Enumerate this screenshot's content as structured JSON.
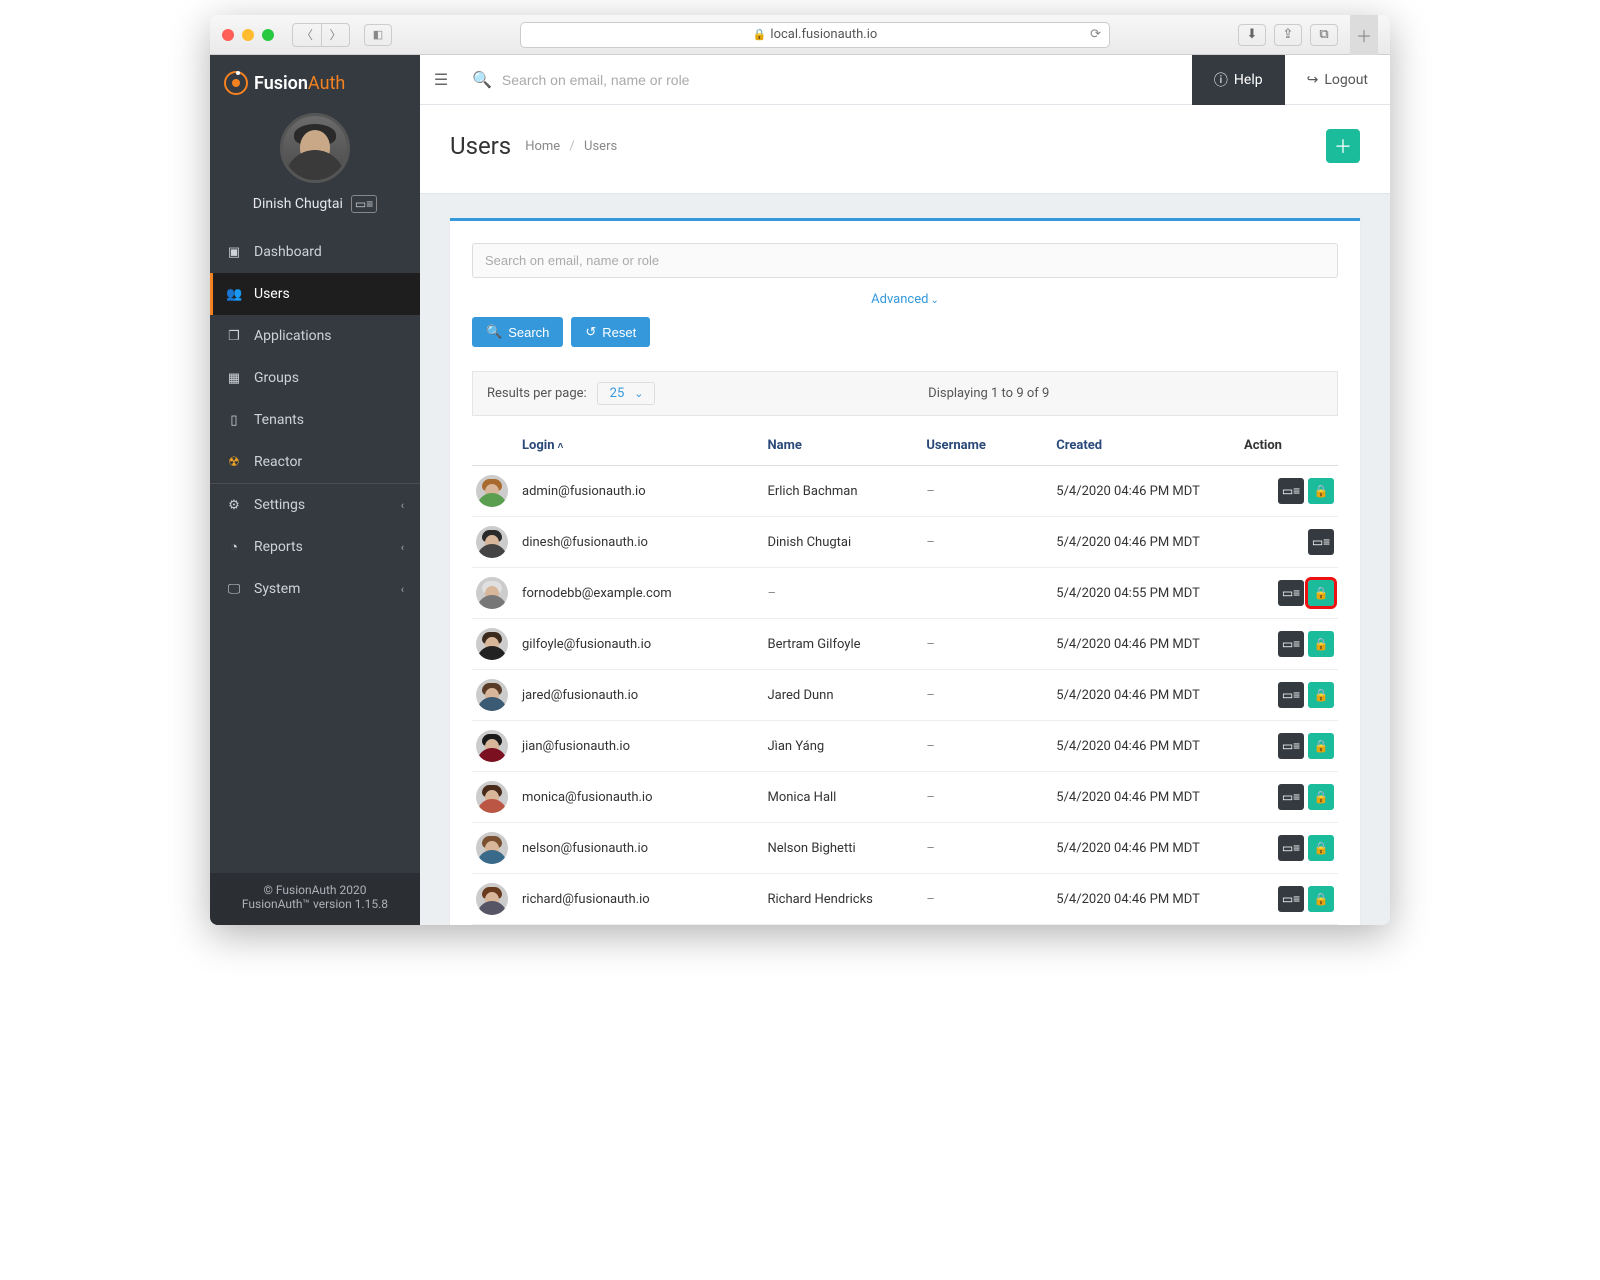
{
  "browser": {
    "url": "local.fusionauth.io"
  },
  "brand": {
    "name_primary": "Fusion",
    "name_secondary": "Auth"
  },
  "current_user": {
    "name": "Dinish Chugtai"
  },
  "sidebar": {
    "items": [
      {
        "label": "Dashboard",
        "icon": "dashboard-icon"
      },
      {
        "label": "Users",
        "icon": "users-icon"
      },
      {
        "label": "Applications",
        "icon": "applications-icon"
      },
      {
        "label": "Groups",
        "icon": "groups-icon"
      },
      {
        "label": "Tenants",
        "icon": "tenants-icon"
      },
      {
        "label": "Reactor",
        "icon": "reactor-icon"
      },
      {
        "label": "Settings",
        "icon": "settings-icon"
      },
      {
        "label": "Reports",
        "icon": "reports-icon"
      },
      {
        "label": "System",
        "icon": "system-icon"
      }
    ],
    "footer_line1": "© FusionAuth 2020",
    "footer_line2": "FusionAuth™ version 1.15.8"
  },
  "topbar": {
    "search_placeholder": "Search on email, name or role",
    "help": "Help",
    "logout": "Logout"
  },
  "page": {
    "title": "Users",
    "breadcrumb": {
      "home": "Home",
      "current": "Users"
    }
  },
  "panel": {
    "search_placeholder": "Search on email, name or role",
    "advanced": "Advanced",
    "search_btn": "Search",
    "reset_btn": "Reset"
  },
  "pager": {
    "label": "Results per page:",
    "value": "25",
    "status": "Displaying 1 to 9 of 9"
  },
  "table": {
    "columns": {
      "login": "Login",
      "name": "Name",
      "username": "Username",
      "created": "Created",
      "action": "Action"
    },
    "rows": [
      {
        "login": "admin@fusionauth.io",
        "name": "Erlich Bachman",
        "username": "–",
        "created": "5/4/2020 04:46 PM MDT",
        "hair": "#a86a2f",
        "shirt": "#5a9e50",
        "lock": true,
        "highlight": false
      },
      {
        "login": "dinesh@fusionauth.io",
        "name": "Dinish Chugtai",
        "username": "–",
        "created": "5/4/2020 04:46 PM MDT",
        "hair": "#2a2a2a",
        "shirt": "#444",
        "lock": false,
        "highlight": false
      },
      {
        "login": "fornodebb@example.com",
        "name": "–",
        "username": "",
        "created": "5/4/2020 04:55 PM MDT",
        "hair": "#e0e0e0",
        "shirt": "#777",
        "lock": true,
        "highlight": true
      },
      {
        "login": "gilfoyle@fusionauth.io",
        "name": "Bertram Gilfoyle",
        "username": "–",
        "created": "5/4/2020 04:46 PM MDT",
        "hair": "#3a2a1e",
        "shirt": "#222",
        "lock": true,
        "highlight": false
      },
      {
        "login": "jared@fusionauth.io",
        "name": "Jared Dunn",
        "username": "–",
        "created": "5/4/2020 04:46 PM MDT",
        "hair": "#5a3d28",
        "shirt": "#3b5a74",
        "lock": true,
        "highlight": false
      },
      {
        "login": "jian@fusionauth.io",
        "name": "Jìan Yáng",
        "username": "–",
        "created": "5/4/2020 04:46 PM MDT",
        "hair": "#1a1a1a",
        "shirt": "#7a1020",
        "lock": true,
        "highlight": false
      },
      {
        "login": "monica@fusionauth.io",
        "name": "Monica Hall",
        "username": "–",
        "created": "5/4/2020 04:46 PM MDT",
        "hair": "#4a2a1a",
        "shirt": "#b54",
        "lock": true,
        "highlight": false
      },
      {
        "login": "nelson@fusionauth.io",
        "name": "Nelson Bighetti",
        "username": "–",
        "created": "5/4/2020 04:46 PM MDT",
        "hair": "#7a5030",
        "shirt": "#3a6a8a",
        "lock": true,
        "highlight": false
      },
      {
        "login": "richard@fusionauth.io",
        "name": "Richard Hendricks",
        "username": "–",
        "created": "5/4/2020 04:46 PM MDT",
        "hair": "#6a3a1f",
        "shirt": "#556",
        "lock": true,
        "highlight": false
      }
    ]
  }
}
